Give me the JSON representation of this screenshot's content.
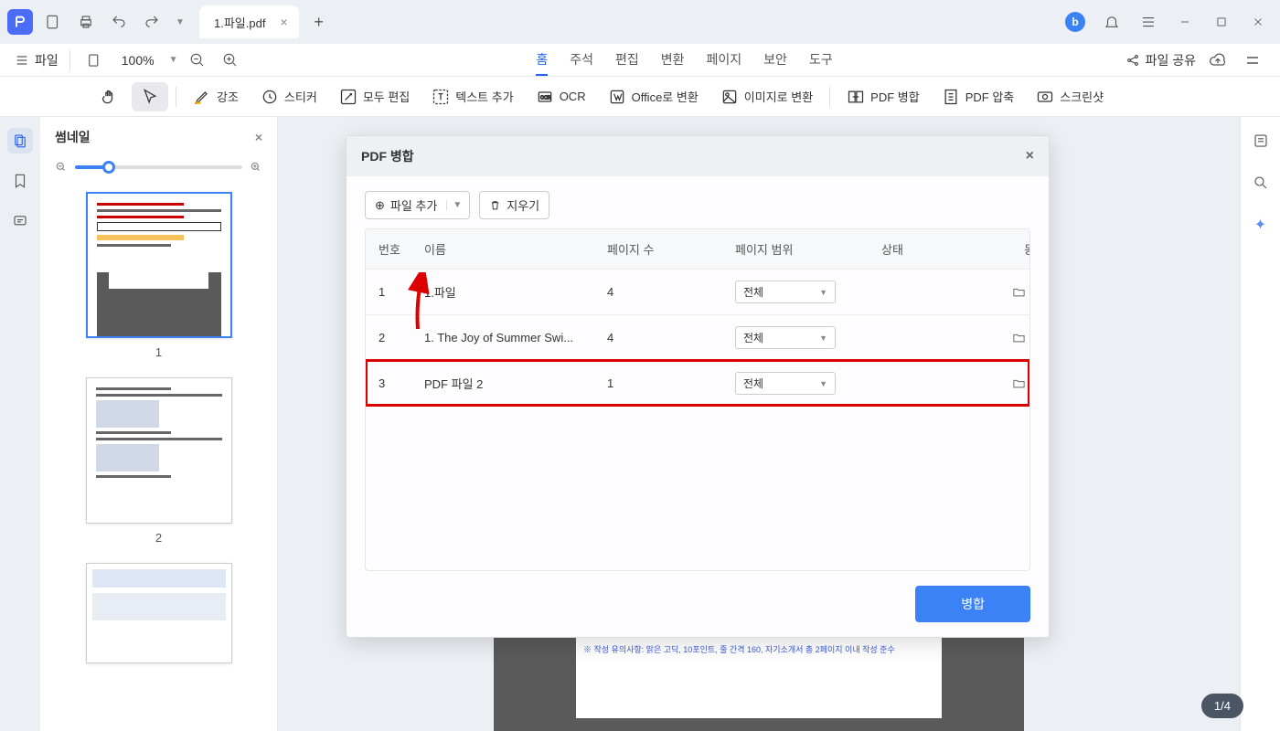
{
  "titlebar": {
    "tab_title": "1.파일.pdf"
  },
  "menubar": {
    "file": "파일",
    "zoom": "100%",
    "tabs": {
      "home": "홈",
      "annot": "주석",
      "edit": "편집",
      "convert": "변환",
      "page": "페이지",
      "secure": "보안",
      "tools": "도구"
    },
    "share": "파일 공유"
  },
  "toolbar": {
    "highlight": "강조",
    "sticker": "스티커",
    "edit_all": "모두 편집",
    "text_add": "텍스트 추가",
    "ocr": "OCR",
    "to_office": "Office로 변환",
    "to_image": "이미지로 변환",
    "merge": "PDF 병합",
    "compress": "PDF 압축",
    "screenshot": "스크린샷"
  },
  "thumbnail": {
    "title": "썸네일",
    "pages": [
      "1",
      "2"
    ]
  },
  "dialog": {
    "title": "PDF 병합",
    "add_file": "파일 추가",
    "clear": "지우기",
    "headers": {
      "num": "번호",
      "name": "이름",
      "pages": "페이지 수",
      "range": "페이지 범위",
      "status": "상태",
      "action": "동작"
    },
    "rows": [
      {
        "num": "1",
        "name": "1.파일",
        "pages": "4",
        "range": "전체"
      },
      {
        "num": "2",
        "name": "1. The Joy of Summer Swi...",
        "pages": "4",
        "range": "전체"
      },
      {
        "num": "3",
        "name": "PDF 파일 2",
        "pages": "1",
        "range": "전체"
      }
    ],
    "merge_btn": "병합"
  },
  "page_doc_note": "※ 작성 유의사항: 맑은 고딕, 10포인트, 줄 간격 160, 자기소개서 총 2페이지 이내 작성 준수",
  "page_indicator": "1/4"
}
